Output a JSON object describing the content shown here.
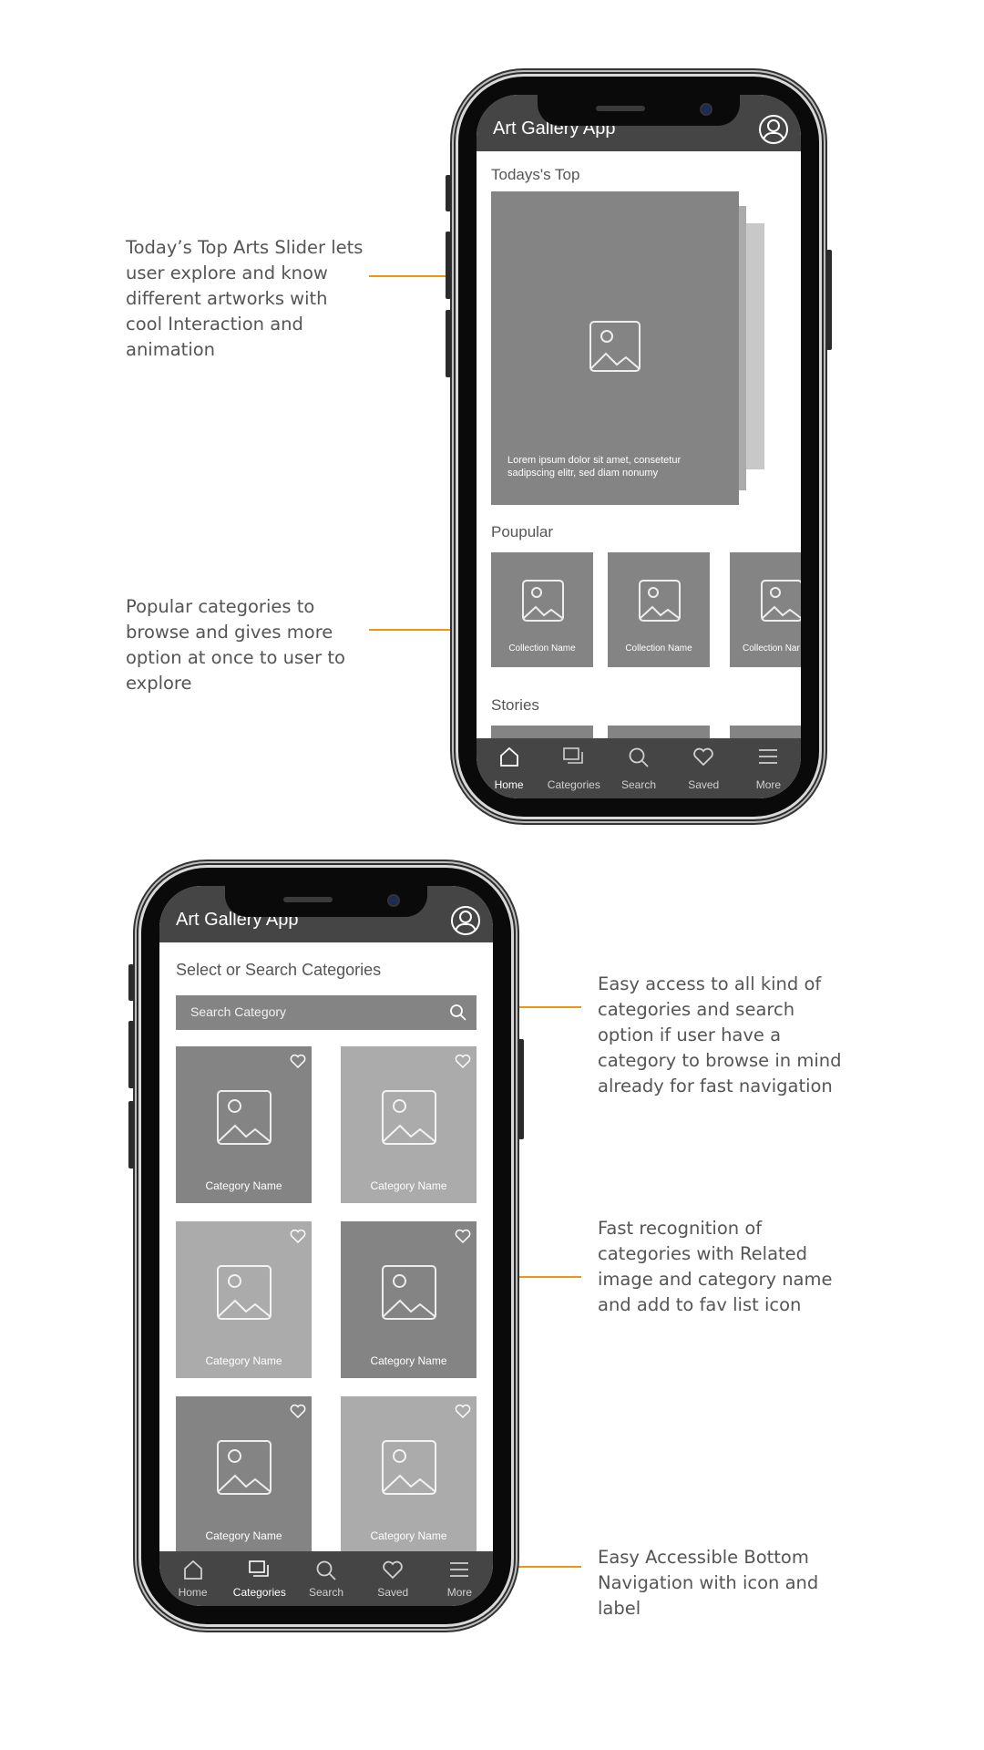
{
  "annotations": {
    "top_slider": "Today’s Top Arts Slider lets\nuser explore and know\ndifferent artworks with\ncool Interaction and\nanimation",
    "popular": "Popular categories to\nbrowse and gives more\noption at once to user to\nexplore",
    "search": "Easy access to all kind of\ncategories and search\noption if user have a\ncategory to browse in mind\nalready for fast navigation",
    "recognition": "Fast recognition of\ncategories with Related\nimage and category name\nand add to fav list icon",
    "bottom_nav": "Easy Accessible Bottom\nNavigation with icon and\nlabel"
  },
  "home_screen": {
    "app_title": "Art Gallery App",
    "todays_top_label": "Todays's Top",
    "slide_caption": "Lorem ipsum dolor sit amet, consetetur\nsadipscing elitr, sed diam nonumy",
    "popular_label": "Poupular",
    "collections": [
      "Collection Name",
      "Collection Name",
      "Collection Nar"
    ],
    "stories_label": "Stories",
    "nav": [
      {
        "label": "Home",
        "icon": "home-icon",
        "active": true
      },
      {
        "label": "Categories",
        "icon": "categories-icon",
        "active": false
      },
      {
        "label": "Search",
        "icon": "search-icon",
        "active": false
      },
      {
        "label": "Saved",
        "icon": "heart-icon",
        "active": false
      },
      {
        "label": "More",
        "icon": "menu-icon",
        "active": false
      }
    ]
  },
  "categories_screen": {
    "app_title": "Art Gallery App",
    "heading": "Select or Search Categories",
    "search_placeholder": "Search Category",
    "categories": [
      {
        "name": "Category Name",
        "tone": "#848484"
      },
      {
        "name": "Category Name",
        "tone": "#ababab"
      },
      {
        "name": "Category Name",
        "tone": "#ababab"
      },
      {
        "name": "Category Name",
        "tone": "#848484"
      },
      {
        "name": "Category Name",
        "tone": "#848484"
      },
      {
        "name": "Category Name",
        "tone": "#ababab"
      }
    ],
    "nav": [
      {
        "label": "Home",
        "icon": "home-icon",
        "active": false
      },
      {
        "label": "Categories",
        "icon": "categories-icon",
        "active": true
      },
      {
        "label": "Search",
        "icon": "search-icon",
        "active": false
      },
      {
        "label": "Saved",
        "icon": "heart-icon",
        "active": false
      },
      {
        "label": "More",
        "icon": "menu-icon",
        "active": false
      }
    ]
  },
  "colors": {
    "accent_arrow": "#f0960f",
    "appbar": "#454545",
    "tile_dark": "#848484",
    "tile_light": "#ababab"
  }
}
